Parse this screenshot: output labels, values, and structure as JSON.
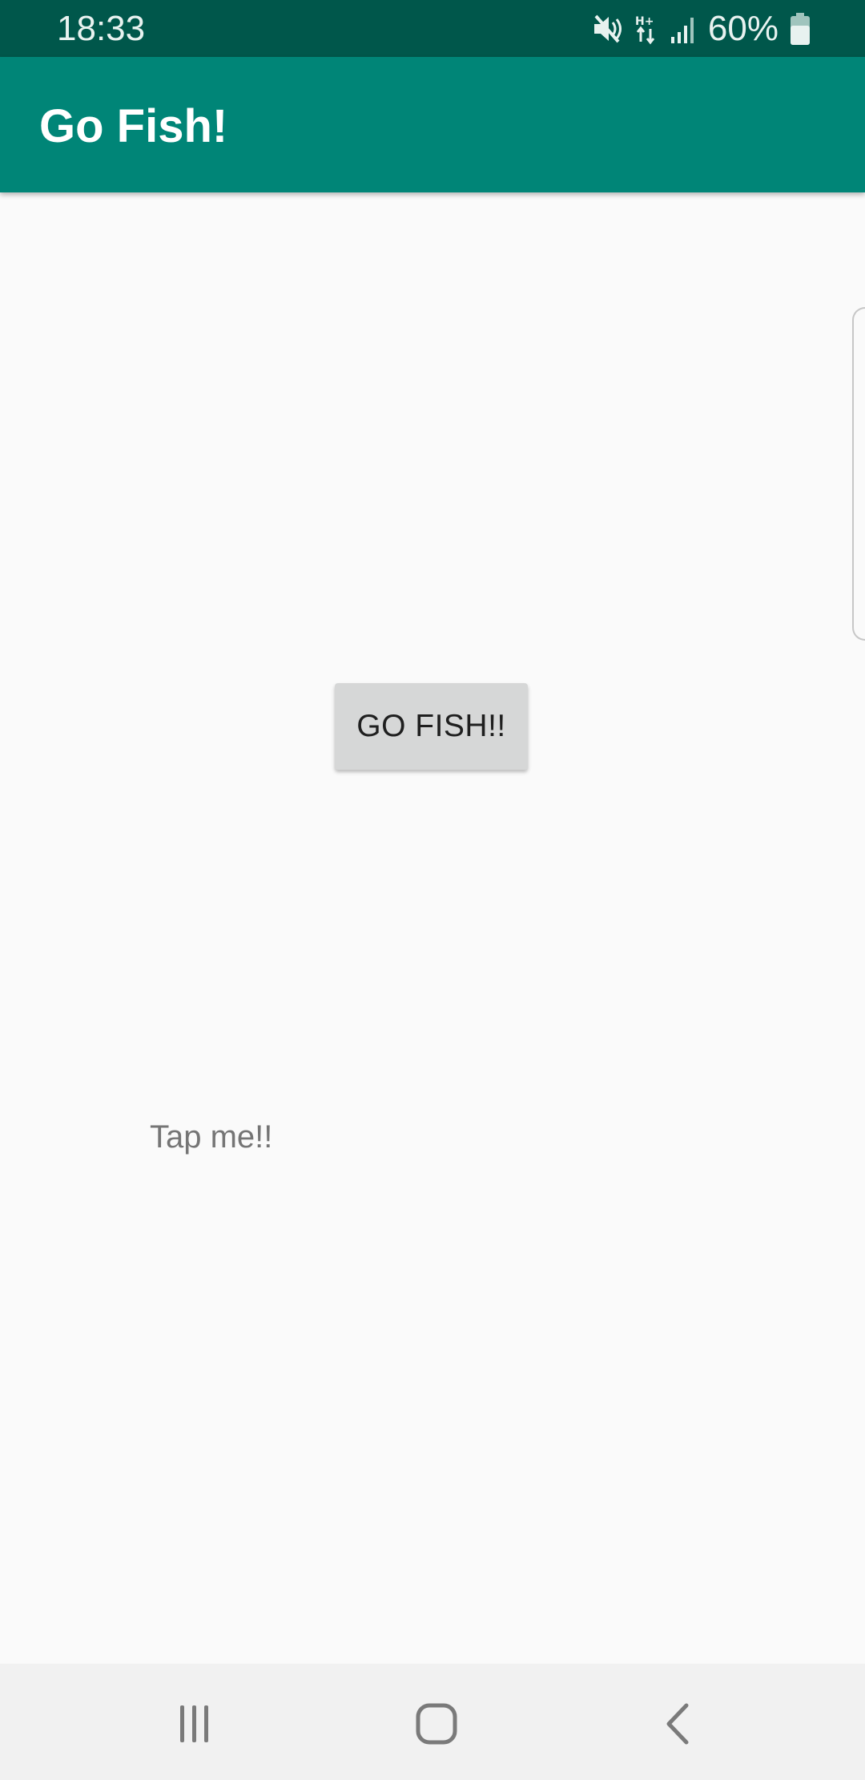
{
  "status_bar": {
    "time": "18:33",
    "battery_percent": "60%",
    "icons": [
      "mute-icon",
      "hplus-data-icon",
      "signal-icon",
      "battery-icon"
    ]
  },
  "app_bar": {
    "title": "Go Fish!",
    "color": "#008577",
    "status_color": "#00574b"
  },
  "main": {
    "button_label": "GO FISH!!",
    "tap_text": "Tap me!!"
  },
  "nav_bar": {
    "buttons": [
      "recents-icon",
      "home-icon",
      "back-icon"
    ]
  }
}
